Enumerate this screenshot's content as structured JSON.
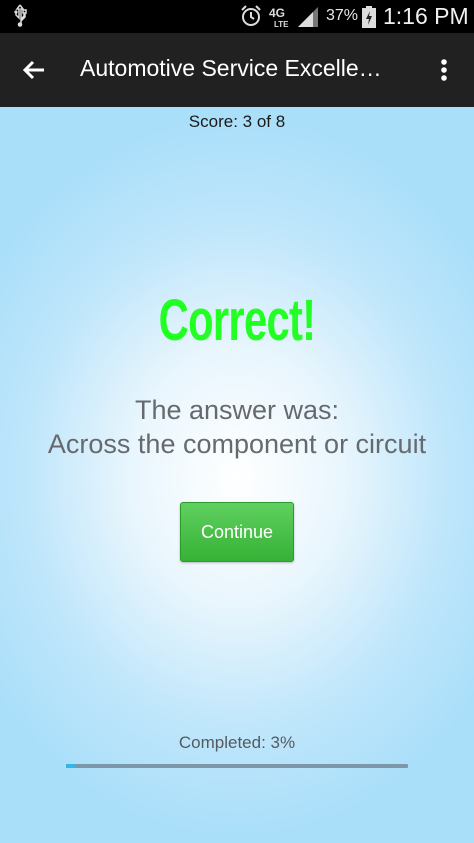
{
  "status_bar": {
    "battery_percent": "37%",
    "time": "1:16 PM",
    "icons": [
      "usb-icon",
      "alarm-icon",
      "4g-lte-icon",
      "signal-icon",
      "battery-icon"
    ]
  },
  "app_bar": {
    "title": "Automotive Service Excelle…",
    "back_icon": "arrow-left-icon",
    "overflow_icon": "more-vertical-icon"
  },
  "quiz": {
    "score": "Score: 3 of 8",
    "result": "Correct!",
    "answer_label": "The answer was:",
    "answer_text": "Across the component or circuit",
    "continue_label": "Continue",
    "completed_label": "Completed: 3%",
    "progress_percent": 3
  },
  "colors": {
    "result": "#22ff22",
    "button": "#3dbb3d",
    "progress_fill": "#33b5e5",
    "progress_track": "#7d97a8",
    "app_bar": "#212121"
  }
}
